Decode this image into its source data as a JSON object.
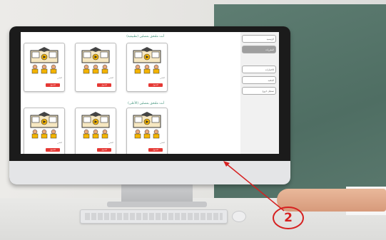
{
  "sidebar": {
    "items": [
      {
        "label": "الرئيسية",
        "active": false
      },
      {
        "label": "المقررات",
        "active": true
      },
      {
        "label": "الاختبارات",
        "active": false
      },
      {
        "label": "المكتبة",
        "active": false
      },
      {
        "label": "تسجيل خروج",
        "active": false
      }
    ]
  },
  "sections": [
    {
      "title": "أنت ملتحق بفصلين (تطبيقية)",
      "cards": [
        {
          "title": "المقرر",
          "action": "الدخول"
        },
        {
          "title": "المقرر",
          "action": "الدخول"
        },
        {
          "title": "المقرر",
          "action": "الدخول"
        }
      ]
    },
    {
      "title": "أنت ملتحق بفصلين (الأعلى)",
      "cards": [
        {
          "title": "المقرر",
          "action": "الدخول"
        },
        {
          "title": "المقرر",
          "action": "الدخول"
        },
        {
          "title": "المقرر",
          "action": "الدخول"
        }
      ]
    }
  ],
  "annotation": {
    "label": "2",
    "color": "#d62020"
  },
  "icons": [
    "graduation-cap-icon",
    "video-play-icon",
    "students-icon"
  ],
  "colors": {
    "accent_green": "#3a8f76",
    "button_red": "#e53935",
    "chalkboard": "#56766b"
  }
}
